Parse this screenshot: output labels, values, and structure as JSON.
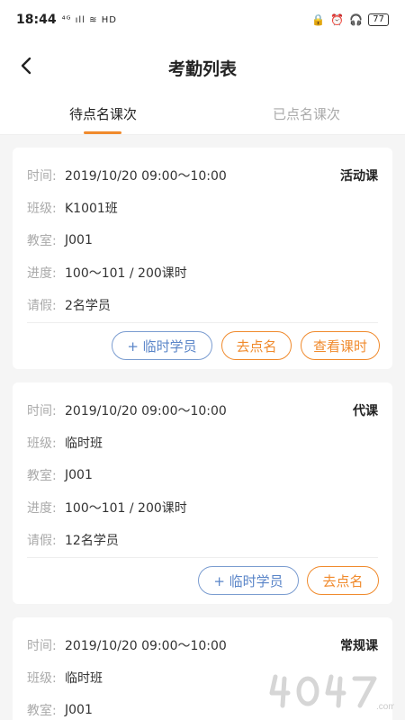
{
  "status": {
    "time": "18:44",
    "left_icons": "⁴ᴳ ıll ≋ HD",
    "battery": "77"
  },
  "header": {
    "title": "考勤列表"
  },
  "tabs": [
    {
      "label": "待点名课次",
      "active": true
    },
    {
      "label": "已点名课次",
      "active": false
    }
  ],
  "labels": {
    "time": "时间:",
    "class": "班级:",
    "room": "教室:",
    "progress": "进度:",
    "leave": "请假:"
  },
  "buttons": {
    "temp_student": "+ 临时学员",
    "go_rollcall": "去点名",
    "view_hours": "查看课时"
  },
  "cards": [
    {
      "type": "活动课",
      "time": "2019/10/20 09:00～10:00",
      "class": "K1001班",
      "room": "J001",
      "progress": "100～101 / 200课时",
      "leave": "2名学员"
    },
    {
      "type": "代课",
      "time": "2019/10/20 09:00～10:00",
      "class": "临时班",
      "room": "J001",
      "progress": "100～101 / 200课时",
      "leave": "12名学员"
    },
    {
      "type": "常规课",
      "time": "2019/10/20 09:00～10:00",
      "class": "临时班",
      "room": "J001"
    }
  ],
  "colors": {
    "accent": "#f08a2c",
    "blue": "#5a85c8"
  }
}
